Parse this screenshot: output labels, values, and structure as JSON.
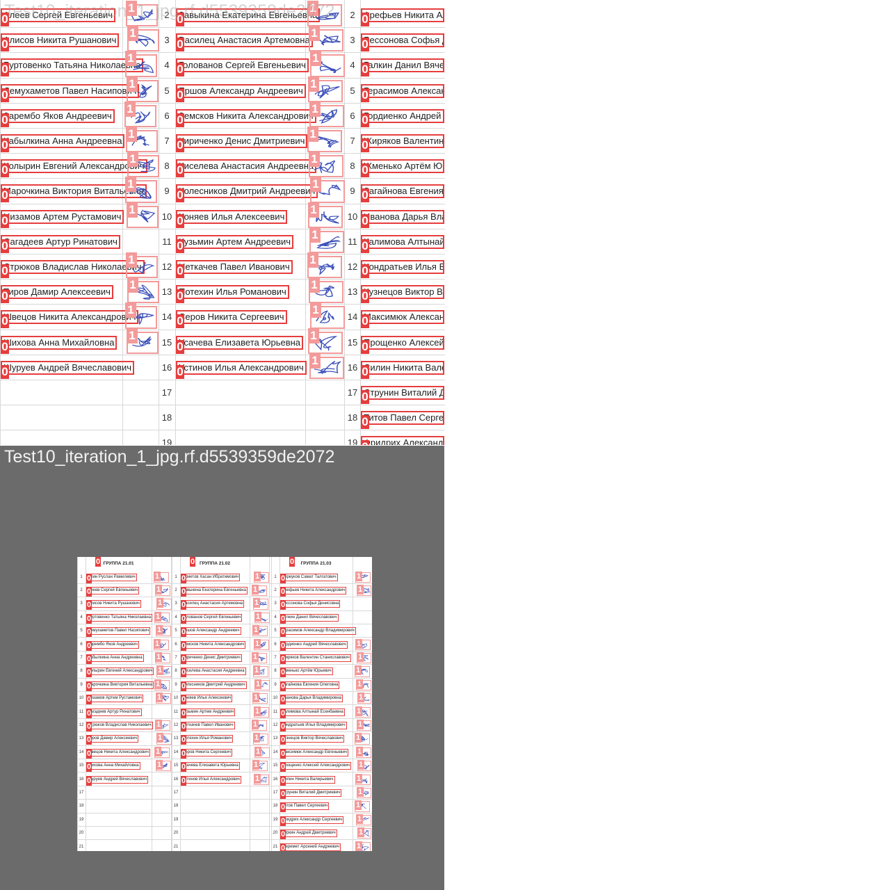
{
  "tiles": {
    "top": {
      "title": "Test10_iteration_1_jpg.rf.d5539359de2072"
    },
    "bottom": {
      "title": "Test10_iteration_1_jpg.rf.d5539359de2072"
    }
  },
  "class_labels": {
    "name": "0",
    "signature": "1"
  },
  "colors": {
    "name_box": "#e63d3d",
    "signature_box": "#f39a9a",
    "background": "#6b6b6b",
    "ink": "#3b4fb8"
  },
  "groups": [
    {
      "title": "ГРУППА 21.01",
      "rows": [
        {
          "n": "1",
          "name": "Алин Руслан Рамилевич",
          "signed": true
        },
        {
          "n": "2",
          "name": "Алеев Сергей Евгеньевич",
          "signed": true
        },
        {
          "n": "3",
          "name": "Алисов Никита Рушанович",
          "signed": true
        },
        {
          "n": "4",
          "name": "Буртовенко Татьяна Николаевна",
          "signed": true
        },
        {
          "n": "5",
          "name": "Демухаметов Павел Насипович",
          "signed": true
        },
        {
          "n": "6",
          "name": "Зарембо Яков Андреевич",
          "signed": true
        },
        {
          "n": "7",
          "name": "Кабылкина Анна Андреевна",
          "signed": true
        },
        {
          "n": "8",
          "name": "Колырин Евгений Александрович",
          "signed": true
        },
        {
          "n": "9",
          "name": "Марочкина Виктория Витальевна",
          "signed": true
        },
        {
          "n": "10",
          "name": "Низамов Артем Рустамович",
          "signed": true
        },
        {
          "n": "11",
          "name": "Сагадеев Артур Ринатович",
          "signed": false
        },
        {
          "n": "12",
          "name": "Стрюков Владислав Николаевич",
          "signed": true
        },
        {
          "n": "13",
          "name": "Тиров Дамир Алексеевич",
          "signed": true
        },
        {
          "n": "14",
          "name": "Швецов Никита Александрович",
          "signed": true
        },
        {
          "n": "15",
          "name": "Шихова Анна Михайловна",
          "signed": true
        },
        {
          "n": "16",
          "name": "Шуруев Андрей Вячеславович",
          "signed": false
        },
        {
          "n": "17",
          "name": "",
          "signed": false
        },
        {
          "n": "18",
          "name": "",
          "signed": false
        },
        {
          "n": "19",
          "name": "",
          "signed": false
        },
        {
          "n": "20",
          "name": "",
          "signed": false
        },
        {
          "n": "21",
          "name": "",
          "signed": false
        }
      ]
    },
    {
      "title": "ГРУППА 21.02",
      "rows": [
        {
          "n": "1",
          "name": "Ахметов Хасан Ибратимович",
          "signed": true
        },
        {
          "n": "2",
          "name": "Завыкина Екатерина Евгеньевна",
          "signed": true
        },
        {
          "n": "3",
          "name": "Василец Анастасия Артемовна",
          "signed": true
        },
        {
          "n": "4",
          "name": "Голованов Сергей Евгеньевич",
          "signed": true
        },
        {
          "n": "5",
          "name": "Ершов Александр Андреевич",
          "signed": true
        },
        {
          "n": "6",
          "name": "Земсков Никита Александрович",
          "signed": true
        },
        {
          "n": "7",
          "name": "Кириченко Денис Дмитриевич",
          "signed": true
        },
        {
          "n": "8",
          "name": "Киселева Анастасия Андреевна",
          "signed": true
        },
        {
          "n": "9",
          "name": "Колесников Дмитрий Андреевич",
          "signed": true
        },
        {
          "n": "10",
          "name": "Коняев Илья Алексеевич",
          "signed": true
        },
        {
          "n": "11",
          "name": "Кузьмин Артем Андреевич",
          "signed": true
        },
        {
          "n": "12",
          "name": "Неткачев Павел Иванович",
          "signed": true
        },
        {
          "n": "13",
          "name": "Потехин Илья Романович",
          "signed": true
        },
        {
          "n": "14",
          "name": "Серов Никита Сергеевич",
          "signed": true
        },
        {
          "n": "15",
          "name": "Усачева Елизавета Юрьевна",
          "signed": true
        },
        {
          "n": "16",
          "name": "Устинов Илья Александрович",
          "signed": true
        },
        {
          "n": "17",
          "name": "",
          "signed": false
        },
        {
          "n": "18",
          "name": "",
          "signed": false
        },
        {
          "n": "19",
          "name": "",
          "signed": false
        },
        {
          "n": "20",
          "name": "",
          "signed": false
        },
        {
          "n": "21",
          "name": "",
          "signed": false
        }
      ]
    },
    {
      "title": "ГРУППА 21.03",
      "rows": [
        {
          "n": "1",
          "name": "Абреуков Самат Талгатович",
          "signed": true
        },
        {
          "n": "2",
          "name": "Арефьев Никита Александрович",
          "signed": true
        },
        {
          "n": "3",
          "name": "Бессонова Софья Денисовна",
          "signed": false
        },
        {
          "n": "4",
          "name": "Галкин Данил Вячеславович",
          "signed": false
        },
        {
          "n": "5",
          "name": "Герасимов Александр Владимирович",
          "signed": false
        },
        {
          "n": "6",
          "name": "Гордиенко Андрей Вячеславович",
          "signed": true
        },
        {
          "n": "7",
          "name": "Жиряков Валентин Станиславович",
          "signed": true
        },
        {
          "n": "8",
          "name": "Жменько Артём Юрьевич",
          "signed": true
        },
        {
          "n": "9",
          "name": "Загайнова Евгения Олеговна",
          "signed": true
        },
        {
          "n": "10",
          "name": "Иванова Дарья Владимировна",
          "signed": true
        },
        {
          "n": "11",
          "name": "Калимова Алтынай Есенбаевна",
          "signed": true
        },
        {
          "n": "12",
          "name": "Кондратьев Илья Владимирович",
          "signed": true
        },
        {
          "n": "13",
          "name": "Кузнецов Виктор Вячеславович",
          "signed": true
        },
        {
          "n": "14",
          "name": "Максимюк Александр Евгеньевич",
          "signed": true
        },
        {
          "n": "15",
          "name": "Прощенко Алексей Александрович",
          "signed": true
        },
        {
          "n": "16",
          "name": "Силин Никита Валерьевич",
          "signed": true
        },
        {
          "n": "17",
          "name": "Струнин Виталий Дмитриевич",
          "signed": true
        },
        {
          "n": "18",
          "name": "Титов Павел Сергеевич",
          "signed": true
        },
        {
          "n": "19",
          "name": "Фридрих Александр Сергеевич",
          "signed": true
        },
        {
          "n": "20",
          "name": "Чуркин Андрей Дмитриевич",
          "signed": true
        },
        {
          "n": "21",
          "name": "Шеремет Арсений Андреевич",
          "signed": true
        }
      ]
    }
  ]
}
